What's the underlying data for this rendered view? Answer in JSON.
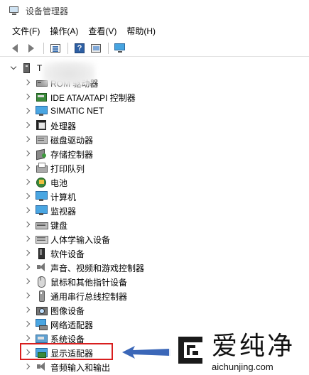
{
  "window": {
    "title": "设备管理器"
  },
  "menu": [
    {
      "label": "文件(F)"
    },
    {
      "label": "操作(A)"
    },
    {
      "label": "查看(V)"
    },
    {
      "label": "帮助(H)"
    }
  ],
  "toolbar": {
    "buttons": [
      {
        "icon": "back-arrow-icon"
      },
      {
        "icon": "forward-arrow-icon"
      },
      {
        "icon": "properties-icon"
      },
      {
        "icon": "help-icon",
        "glyph": "?"
      },
      {
        "icon": "update-driver-icon"
      },
      {
        "icon": "scan-hardware-monitor-icon"
      }
    ]
  },
  "tree": {
    "root": {
      "label": "T",
      "expanded": true
    },
    "categories": [
      {
        "label": "ROM 驱动器",
        "icon": "dvd-drive-icon"
      },
      {
        "label": "IDE ATA/ATAPI 控制器",
        "icon": "ide-controller-icon"
      },
      {
        "label": "SIMATIC NET",
        "icon": "network-monitor-icon"
      },
      {
        "label": "处理器",
        "icon": "processor-icon"
      },
      {
        "label": "磁盘驱动器",
        "icon": "disk-drive-icon"
      },
      {
        "label": "存储控制器",
        "icon": "storage-controller-icon"
      },
      {
        "label": "打印队列",
        "icon": "printer-icon"
      },
      {
        "label": "电池",
        "icon": "battery-icon"
      },
      {
        "label": "计算机",
        "icon": "computer-icon"
      },
      {
        "label": "监视器",
        "icon": "monitor-icon"
      },
      {
        "label": "键盘",
        "icon": "keyboard-icon"
      },
      {
        "label": "人体学输入设备",
        "icon": "hid-icon"
      },
      {
        "label": "软件设备",
        "icon": "software-device-icon"
      },
      {
        "label": "声音、视频和游戏控制器",
        "icon": "sound-icon"
      },
      {
        "label": "鼠标和其他指针设备",
        "icon": "mouse-icon"
      },
      {
        "label": "通用串行总线控制器",
        "icon": "usb-icon"
      },
      {
        "label": "图像设备",
        "icon": "camera-icon"
      },
      {
        "label": "网络适配器",
        "icon": "network-adapter-icon"
      },
      {
        "label": "系统设备",
        "icon": "system-device-icon"
      },
      {
        "label": "显示适配器",
        "icon": "display-adapter-icon",
        "highlighted": true
      },
      {
        "label": "音频输入和输出",
        "icon": "audio-io-icon"
      }
    ]
  },
  "annotation": {
    "highlight_color": "#d81e1e",
    "arrow_color": "#3b67b8"
  },
  "watermark": {
    "brand": "爱纯净",
    "url": "aichunjing.com"
  }
}
